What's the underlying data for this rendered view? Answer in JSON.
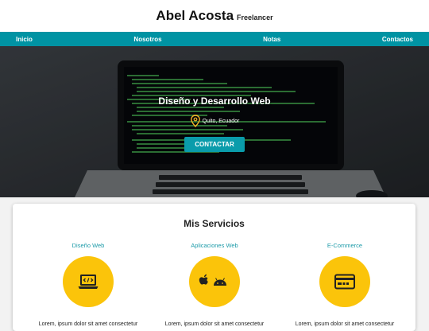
{
  "header": {
    "name": "Abel Acosta",
    "subtitle": "Freelancer"
  },
  "nav": {
    "items": [
      "Inicio",
      "Nosotros",
      "Notas",
      "Contactos"
    ]
  },
  "hero": {
    "title": "Diseño y Desarrollo Web",
    "location": "Quito, Ecuador",
    "button": "CONTACTAR"
  },
  "services": {
    "title": "Mis Servicios",
    "items": [
      {
        "name": "Diseño Web",
        "icon": "laptop-code-icon",
        "desc": "Lorem, ipsum dolor sit amet consectetur"
      },
      {
        "name": "Aplicaciones Web",
        "icon": "apple-android-icon",
        "desc": "Lorem, ipsum dolor sit amet consectetur"
      },
      {
        "name": "E-Commerce",
        "icon": "credit-card-icon",
        "desc": "Lorem, ipsum dolor sit amet consectetur"
      }
    ]
  },
  "colors": {
    "nav": "#0093a3",
    "accent": "#1d9ba9",
    "circle": "#fbc40a",
    "button": "#0a9cab"
  }
}
